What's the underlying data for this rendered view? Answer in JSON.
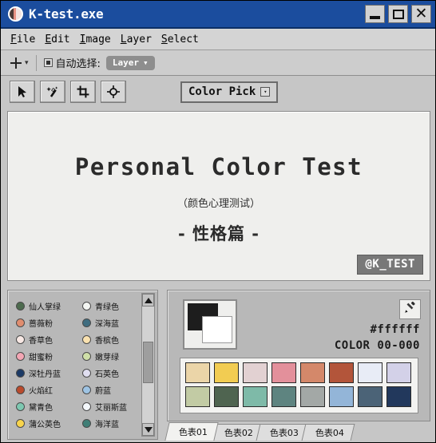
{
  "window": {
    "title": "K-test.exe",
    "icon": "app-icon",
    "buttons": {
      "minimize": "minimize",
      "maximize": "maximize",
      "close": "close"
    },
    "titlebar_color": "#1b4d9e"
  },
  "menubar": {
    "items": [
      {
        "accel": "F",
        "rest": "ile"
      },
      {
        "accel": "E",
        "rest": "dit"
      },
      {
        "accel": "I",
        "rest": "mage"
      },
      {
        "accel": "L",
        "rest": "ayer"
      },
      {
        "accel": "S",
        "rest": "elect"
      }
    ]
  },
  "options_bar": {
    "move_tool_icon": "move-icon",
    "dropdown_caret": "▾",
    "auto_select_label": "自动选择:",
    "auto_select_checked": true,
    "layer_pill": "Layer",
    "layer_pill_caret": "▾"
  },
  "toolbar": {
    "tools": [
      {
        "name": "pointer-tool",
        "icon": "cursor-arrow-icon"
      },
      {
        "name": "magic-wand-tool",
        "icon": "magic-wand-icon"
      },
      {
        "name": "crop-tool",
        "icon": "crop-icon"
      },
      {
        "name": "target-tool",
        "icon": "target-icon"
      }
    ],
    "color_pick_label": "Color Pick",
    "color_pick_caret": "▾"
  },
  "canvas": {
    "title": "Personal Color Test",
    "subtitle": "（颜色心理测试）",
    "section": "- 性格篇 -",
    "badge": "@K_TEST",
    "background": "#efefed"
  },
  "color_list": {
    "left_column": [
      {
        "label": "仙人掌绿",
        "color": "#4d6b4e"
      },
      {
        "label": "蔷薇粉",
        "color": "#e08d6f"
      },
      {
        "label": "香草色",
        "color": "#f7e8e4"
      },
      {
        "label": "甜蜜粉",
        "color": "#f3a6b4"
      },
      {
        "label": "深牡丹蓝",
        "color": "#1c3a66"
      },
      {
        "label": "火焰红",
        "color": "#ba4a2c"
      },
      {
        "label": "黛青色",
        "color": "#7dc8b1"
      },
      {
        "label": "蒲公英色",
        "color": "#f8d44c"
      }
    ],
    "right_column": [
      {
        "label": "青绿色",
        "color": "#f4f6f3"
      },
      {
        "label": "深海蓝",
        "color": "#3f6d80"
      },
      {
        "label": "香槟色",
        "color": "#fae2b0"
      },
      {
        "label": "嫩芽绿",
        "color": "#cfdfa8"
      },
      {
        "label": "石英色",
        "color": "#e0def0"
      },
      {
        "label": "蔚蓝",
        "color": "#9ec4e4"
      },
      {
        "label": "艾丽斯蓝",
        "color": "#f4f8fc"
      },
      {
        "label": "海洋蓝",
        "color": "#3f7e76"
      }
    ],
    "scrollbar": {
      "up_arrow": "scroll-up",
      "down_arrow": "scroll-down"
    }
  },
  "color_panel": {
    "foreground_color": "#1d1d1d",
    "background_color": "#ffffff",
    "eyedropper_icon": "eyedropper-icon",
    "hex_value": "#ffffff",
    "color_code": "COLOR 00-000",
    "swatch_rows": [
      [
        "#ebd5a8",
        "#f2cc52",
        "#e2d1d2",
        "#e3909b",
        "#d4886a",
        "#b3553a",
        "#e8ecf6",
        "#d3d1e8"
      ],
      [
        "#c2cba4",
        "#4f6450",
        "#7ebaa8",
        "#5e8480",
        "#a3a8a6",
        "#93b5d8",
        "#4b6377",
        "#22385c"
      ]
    ]
  },
  "tabs": [
    {
      "label": "色表01",
      "active": true
    },
    {
      "label": "色表02",
      "active": false
    },
    {
      "label": "色表03",
      "active": false
    },
    {
      "label": "色表04",
      "active": false
    }
  ]
}
